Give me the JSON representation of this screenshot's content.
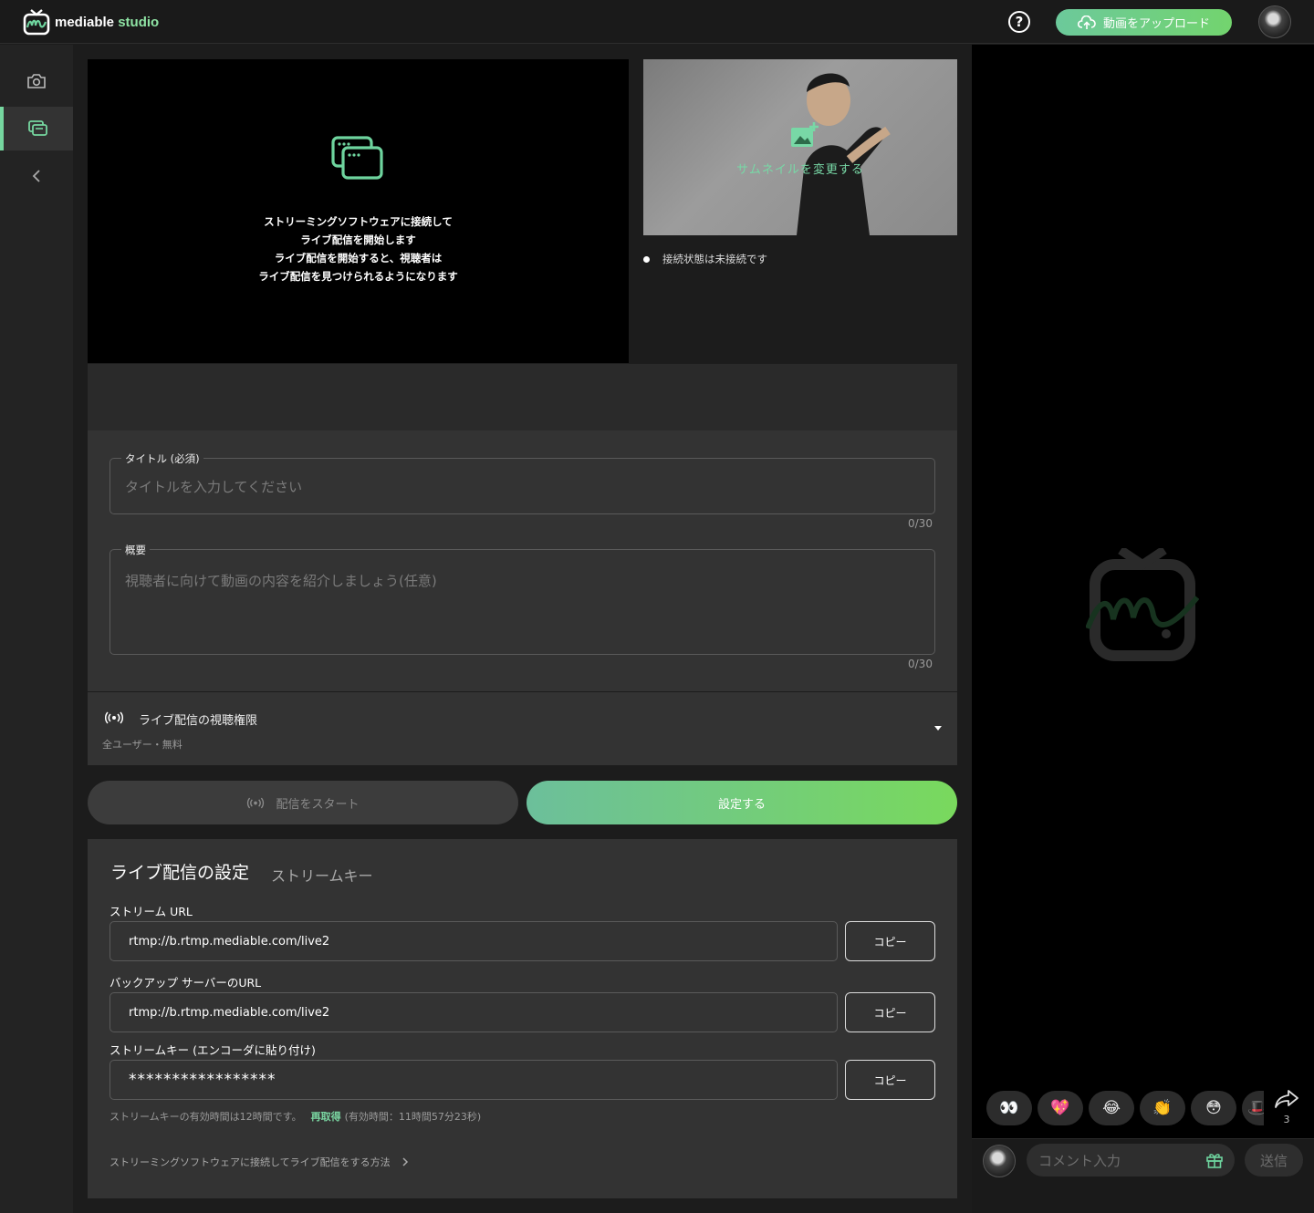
{
  "app": {
    "logo_main": "mediable",
    "logo_accent": " studio"
  },
  "header": {
    "help_symbol": "?",
    "upload_label": "動画をアップロード"
  },
  "sidebar": {
    "items": [
      "camera-icon",
      "windows-icon",
      "chevron-left-icon"
    ],
    "active_index": 1
  },
  "preview": {
    "lines": [
      "ストリーミングソフトウェアに接続して",
      "ライブ配信を開始します",
      "ライブ配信を開始すると、視聴者は",
      "ライブ配信を見つけられるようになります"
    ]
  },
  "thumbnail": {
    "label": "サムネイルを変更する"
  },
  "connection": {
    "status": "接続状態は未接続です"
  },
  "form": {
    "title_label": "タイトル (必須)",
    "title_placeholder": "タイトルを入力してください",
    "title_counter": "0/30",
    "summary_label": "概要",
    "summary_placeholder": "視聴者に向けて動画の内容を紹介しましょう(任意)",
    "summary_counter": "0/30"
  },
  "permission": {
    "title": "ライブ配信の視聴権限",
    "value": "全ユーザー・無料"
  },
  "actions": {
    "start_label": "配信をスタート",
    "set_label": "設定する"
  },
  "settings": {
    "title": "ライブ配信の設定",
    "tab": "ストリームキー",
    "stream_url_label": "ストリーム URL",
    "stream_url": "rtmp://b.rtmp.mediable.com/live2",
    "backup_url_label": "バックアップ サーバーのURL",
    "backup_url": "rtmp://b.rtmp.mediable.com/live2",
    "key_label": "ストリームキー (エンコーダに貼り付け)",
    "key_value": "*****************",
    "copy_label": "コピー",
    "key_note": "ストリームキーの有効時間は12時間です。",
    "refresh_label": "再取得",
    "remaining": "(有効時間：11時間57分23秒)",
    "howto": "ストリーミングソフトウェアに接続してライブ配信をする方法"
  },
  "chat": {
    "emojis": [
      "👀",
      "💖",
      "😂",
      "👏",
      "😳",
      "🎩"
    ],
    "share_count": "3",
    "comment_placeholder": "コメント入力",
    "send_label": "送信"
  },
  "colors": {
    "accent": "#76d7a0",
    "accent_green": "#79d95d",
    "panel": "#333333",
    "bg": "#1c1c1c"
  }
}
